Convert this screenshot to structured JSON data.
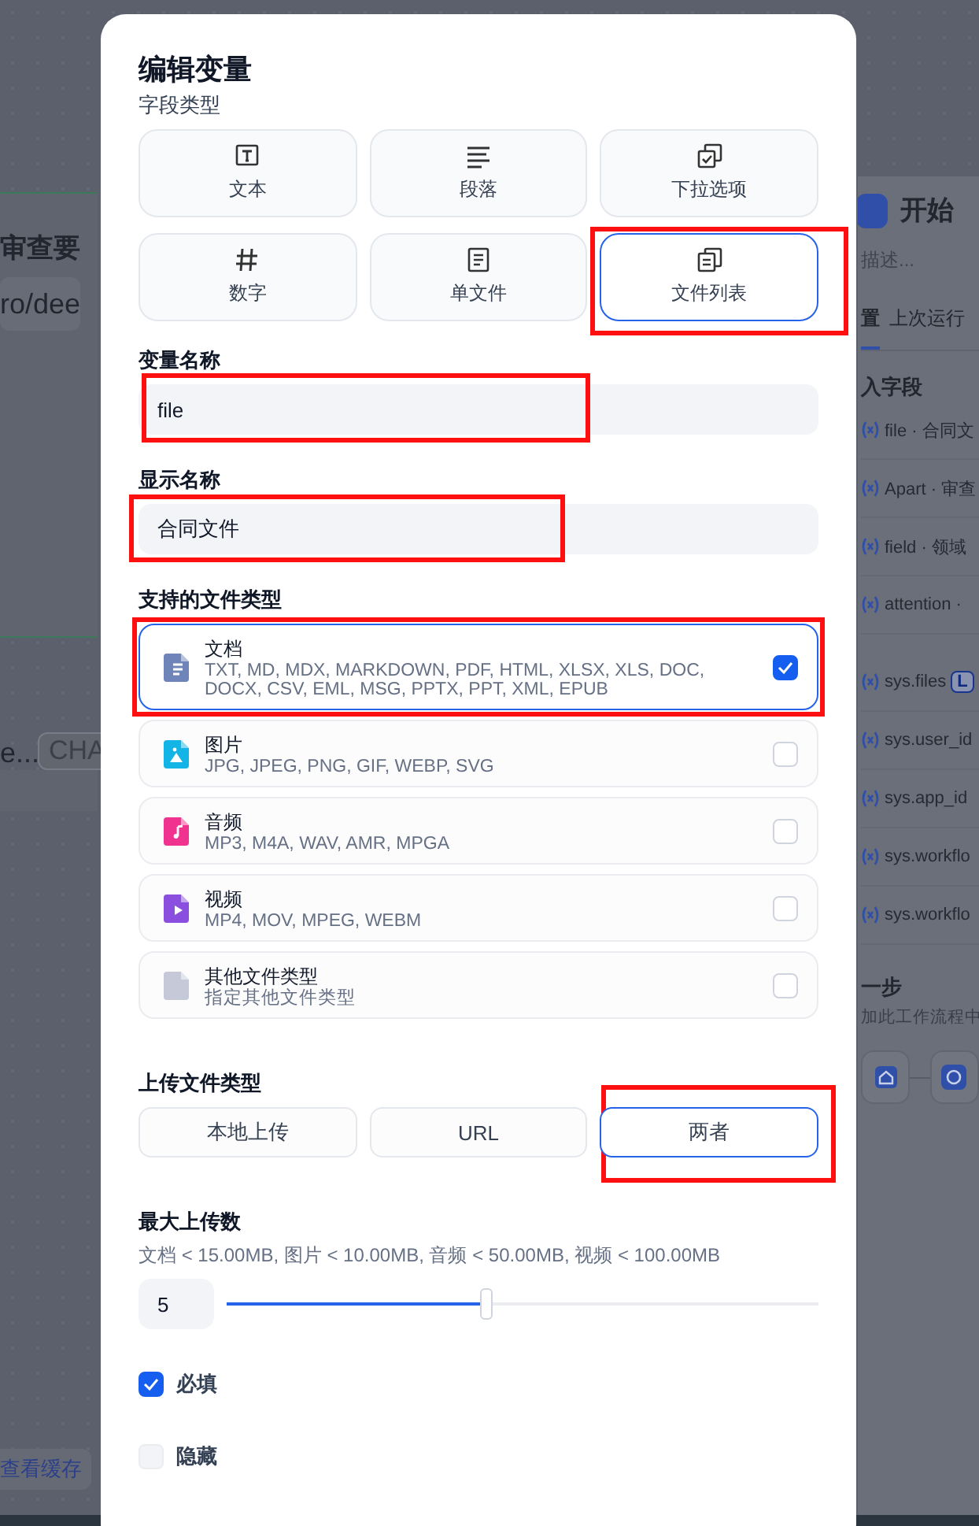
{
  "canvas": {
    "node_title": "审查要",
    "node_field": "ro/dee",
    "node_var": "e...",
    "node_badge": "CHA",
    "cache_link": "查看缓存"
  },
  "start_panel": {
    "title": "开始",
    "description_placeholder": "描述...",
    "tabs": [
      {
        "label": "置",
        "selected": true
      },
      {
        "label": "上次运行",
        "selected": false
      }
    ],
    "section_title": "入字段",
    "fields": [
      {
        "text": "file · 合同文"
      },
      {
        "text": "Apart · 审查"
      },
      {
        "text": "field · 领域"
      },
      {
        "text": "attention ·"
      }
    ],
    "system_fields": [
      {
        "text": "sys.files",
        "badge": "L"
      },
      {
        "text": "sys.user_id"
      },
      {
        "text": "sys.app_id"
      },
      {
        "text": "sys.workflo"
      },
      {
        "text": "sys.workflo"
      }
    ],
    "next_step_title": "一步",
    "next_step_description": "加此工作流程中"
  },
  "modal": {
    "title": "编辑变量",
    "field_type_label": "字段类型",
    "field_types": [
      {
        "kind": "text",
        "label": "文本",
        "selected": false,
        "annotated": false
      },
      {
        "kind": "paragraph",
        "label": "段落",
        "selected": false,
        "annotated": false
      },
      {
        "kind": "select",
        "label": "下拉选项",
        "selected": false,
        "annotated": false
      },
      {
        "kind": "number",
        "label": "数字",
        "selected": false,
        "annotated": false
      },
      {
        "kind": "file",
        "label": "单文件",
        "selected": false,
        "annotated": false
      },
      {
        "kind": "file-list",
        "label": "文件列表",
        "selected": true,
        "annotated": true
      }
    ],
    "variable_name": {
      "label": "变量名称",
      "value": "file",
      "annotated": true
    },
    "display_name": {
      "label": "显示名称",
      "value": "合同文件",
      "annotated": true
    },
    "file_types_label": "支持的文件类型",
    "file_types": [
      {
        "kind": "document",
        "name": "文档",
        "extensions": "TXT, MD, MDX, MARKDOWN, PDF, HTML, XLSX, XLS, DOC, DOCX, CSV, EML, MSG, PPTX, PPT, XML, EPUB",
        "checked": true,
        "annotated": true
      },
      {
        "kind": "image",
        "name": "图片",
        "extensions": "JPG, JPEG, PNG, GIF, WEBP, SVG",
        "checked": false,
        "annotated": false
      },
      {
        "kind": "audio",
        "name": "音频",
        "extensions": "MP3, M4A, WAV, AMR, MPGA",
        "checked": false,
        "annotated": false
      },
      {
        "kind": "video",
        "name": "视频",
        "extensions": "MP4, MOV, MPEG, WEBM",
        "checked": false,
        "annotated": false
      },
      {
        "kind": "other",
        "name": "其他文件类型",
        "extensions": "指定其他文件类型",
        "checked": false,
        "annotated": false
      }
    ],
    "upload_label": "上传文件类型",
    "upload_methods": [
      {
        "label": "本地上传",
        "selected": false,
        "annotated": false
      },
      {
        "label": "URL",
        "selected": false,
        "annotated": false
      },
      {
        "label": "两者",
        "selected": true,
        "annotated": true
      }
    ],
    "max_uploads": {
      "label": "最大上传数",
      "limits": "文档 < 15.00MB, 图片 < 10.00MB, 音频 < 50.00MB, 视频 < 100.00MB",
      "value": "5",
      "level": 0.44
    },
    "options": [
      {
        "label": "必填",
        "checked": true
      },
      {
        "label": "隐藏",
        "checked": false
      }
    ]
  }
}
